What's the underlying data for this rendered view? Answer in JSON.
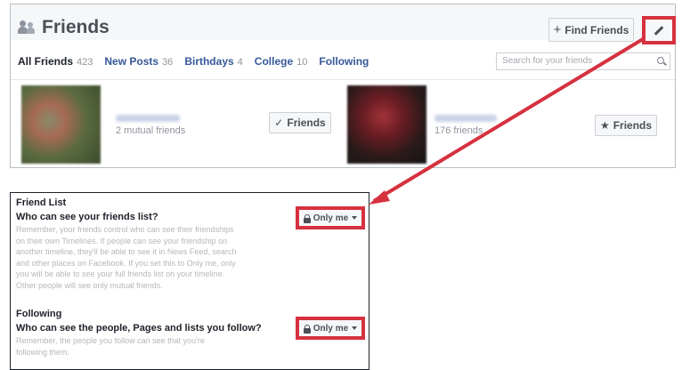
{
  "friends_panel": {
    "title": "Friends",
    "find_friends_label": "Find Friends",
    "tabs": [
      {
        "label": "All Friends",
        "count": "423"
      },
      {
        "label": "New Posts",
        "count": "36"
      },
      {
        "label": "Birthdays",
        "count": "4"
      },
      {
        "label": "College",
        "count": "10"
      },
      {
        "label": "Following",
        "count": ""
      }
    ],
    "search": {
      "placeholder": "Search for your friends"
    },
    "cards": [
      {
        "mutual": "2 mutual friends",
        "button_label": "Friends",
        "button_icon": "checkmark-icon"
      },
      {
        "mutual": "176 friends",
        "button_label": "Friends",
        "button_icon": "star-icon"
      }
    ]
  },
  "settings_panel": {
    "friend_list": {
      "heading": "Friend List",
      "question": "Who can see your friends list?",
      "description_lines": [
        "Remember, your friends control who can see their friendships",
        "on their own Timelines. If people can see your friendship on",
        "another timeline, they'll be able to see it in News Feed, search",
        "and other places on Facebook. If you set this to Only me, only",
        "you will be able to see your full friends list on your timeline.",
        "Other people will see only mutual friends."
      ],
      "privacy_label": "Only me"
    },
    "following": {
      "heading": "Following",
      "question": "Who can see the people, Pages and lists you follow?",
      "description_lines": [
        "Remember, the people you follow can see that you're",
        "following them."
      ],
      "privacy_label": "Only me"
    }
  },
  "colors": {
    "highlight": "#d6313f",
    "link": "#365899",
    "muted": "#90949c"
  }
}
